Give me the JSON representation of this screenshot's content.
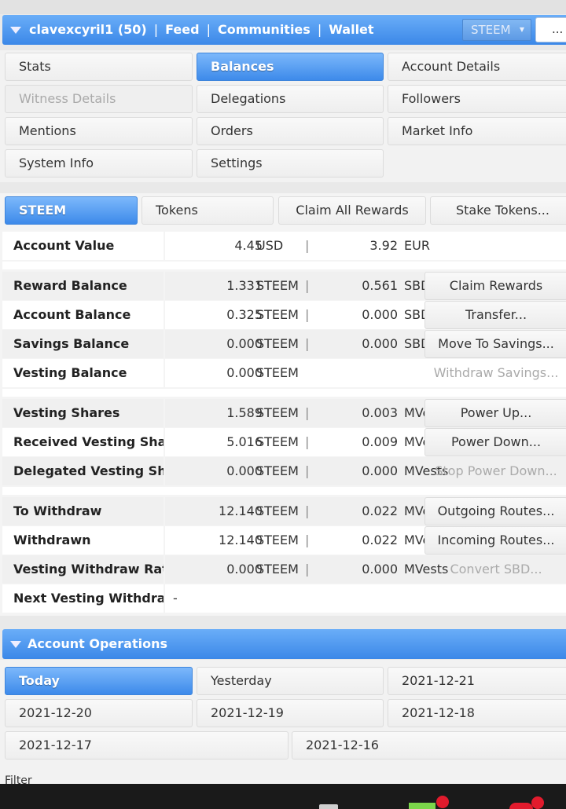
{
  "header": {
    "account": "clavexcyril1 (50)",
    "nav": [
      "Feed",
      "Communities",
      "Wallet"
    ],
    "selector": "STEEM",
    "more": "..."
  },
  "menu": {
    "items": [
      "Stats",
      "Balances",
      "Account Details",
      "Witness Details",
      "Delegations",
      "Followers",
      "Mentions",
      "Orders",
      "Market Info",
      "System Info",
      "Settings"
    ],
    "active": "Balances"
  },
  "tabs": {
    "steem": "STEEM",
    "tokens": "Tokens",
    "claim_all": "Claim All Rewards",
    "stake": "Stake Tokens..."
  },
  "currencies": {
    "steem": "STEEM",
    "sbd": "SBD",
    "mvests": "MVests",
    "usd": "USD",
    "eur": "EUR"
  },
  "account_value": {
    "label": "Account Value",
    "usd": "4.45",
    "eur": "3.92"
  },
  "balances": [
    {
      "label": "Reward Balance",
      "v1": "1.331",
      "u1": "STEEM",
      "v2": "0.561",
      "u2": "SBD",
      "action": "Claim Rewards"
    },
    {
      "label": "Account Balance",
      "v1": "0.325",
      "u1": "STEEM",
      "v2": "0.000",
      "u2": "SBD",
      "action": "Transfer..."
    },
    {
      "label": "Savings Balance",
      "v1": "0.000",
      "u1": "STEEM",
      "v2": "0.000",
      "u2": "SBD",
      "action": "Move To Savings..."
    },
    {
      "label": "Vesting Balance",
      "v1": "0.000",
      "u1": "STEEM",
      "action": "Withdraw Savings..."
    }
  ],
  "vesting": [
    {
      "label": "Vesting Shares",
      "v1": "1.589",
      "u1": "STEEM",
      "v2": "0.003",
      "u2": "MVests",
      "action": "Power Up..."
    },
    {
      "label": "Received Vesting Shares",
      "v1": "5.016",
      "u1": "STEEM",
      "v2": "0.009",
      "u2": "MVests",
      "action": "Power Down..."
    },
    {
      "label": "Delegated Vesting Shares",
      "v1": "0.000",
      "u1": "STEEM",
      "v2": "0.000",
      "u2": "MVests",
      "action": "Stop Power Down..."
    }
  ],
  "withdraw": [
    {
      "label": "To Withdraw",
      "v1": "12.140",
      "u1": "STEEM",
      "v2": "0.022",
      "u2": "MVests",
      "action": "Outgoing Routes..."
    },
    {
      "label": "Withdrawn",
      "v1": "12.140",
      "u1": "STEEM",
      "v2": "0.022",
      "u2": "MVests",
      "action": "Incoming Routes..."
    },
    {
      "label": "Vesting Withdraw Rate",
      "v1": "0.000",
      "u1": "STEEM",
      "v2": "0.000",
      "u2": "MVests",
      "action": "Convert SBD..."
    }
  ],
  "next_withdrawal": {
    "label": "Next Vesting Withdrawal",
    "value": "-"
  },
  "operations": {
    "title": "Account Operations",
    "dates": [
      "Today",
      "Yesterday",
      "2021-12-21",
      "2021-12-20",
      "2021-12-19",
      "2021-12-18",
      "2021-12-17",
      "2021-12-16"
    ],
    "filter": "Filter"
  }
}
